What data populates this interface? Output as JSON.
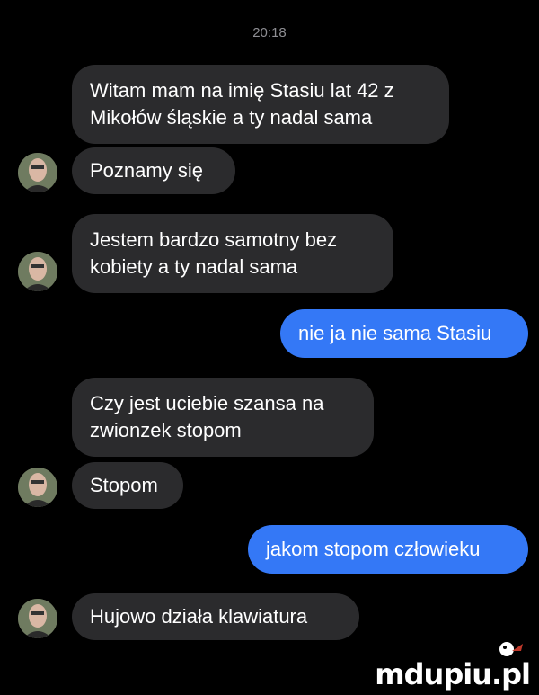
{
  "timestamp": "20:18",
  "messages": [
    {
      "sender": "incoming",
      "lines": [
        "Witam mam na imię Stasiu lat 42 z",
        "Mikołów śląskie a ty nadal sama"
      ]
    },
    {
      "sender": "incoming",
      "lines": [
        "Poznamy się"
      ]
    },
    {
      "sender": "incoming",
      "lines": [
        "Jestem bardzo samotny bez",
        "kobiety a ty nadal sama"
      ]
    },
    {
      "sender": "outgoing",
      "lines": [
        "nie ja nie sama Stasiu"
      ]
    },
    {
      "sender": "incoming",
      "lines": [
        "Czy jest uciebie szansa na",
        "zwionzek stopom"
      ]
    },
    {
      "sender": "incoming",
      "lines": [
        "Stopom"
      ]
    },
    {
      "sender": "outgoing",
      "lines": [
        "jakom stopom człowieku"
      ]
    },
    {
      "sender": "incoming",
      "lines": [
        "Hujowo działa klawiatura"
      ]
    }
  ],
  "watermark": "mdupiu.pl",
  "colors": {
    "background": "#000000",
    "incoming_bubble": "#2b2b2d",
    "outgoing_bubble": "#3478f6",
    "timestamp": "#8e8e93"
  },
  "icons": {
    "avatar": "contact-avatar",
    "watermark_mascot": "mascot-icon"
  }
}
